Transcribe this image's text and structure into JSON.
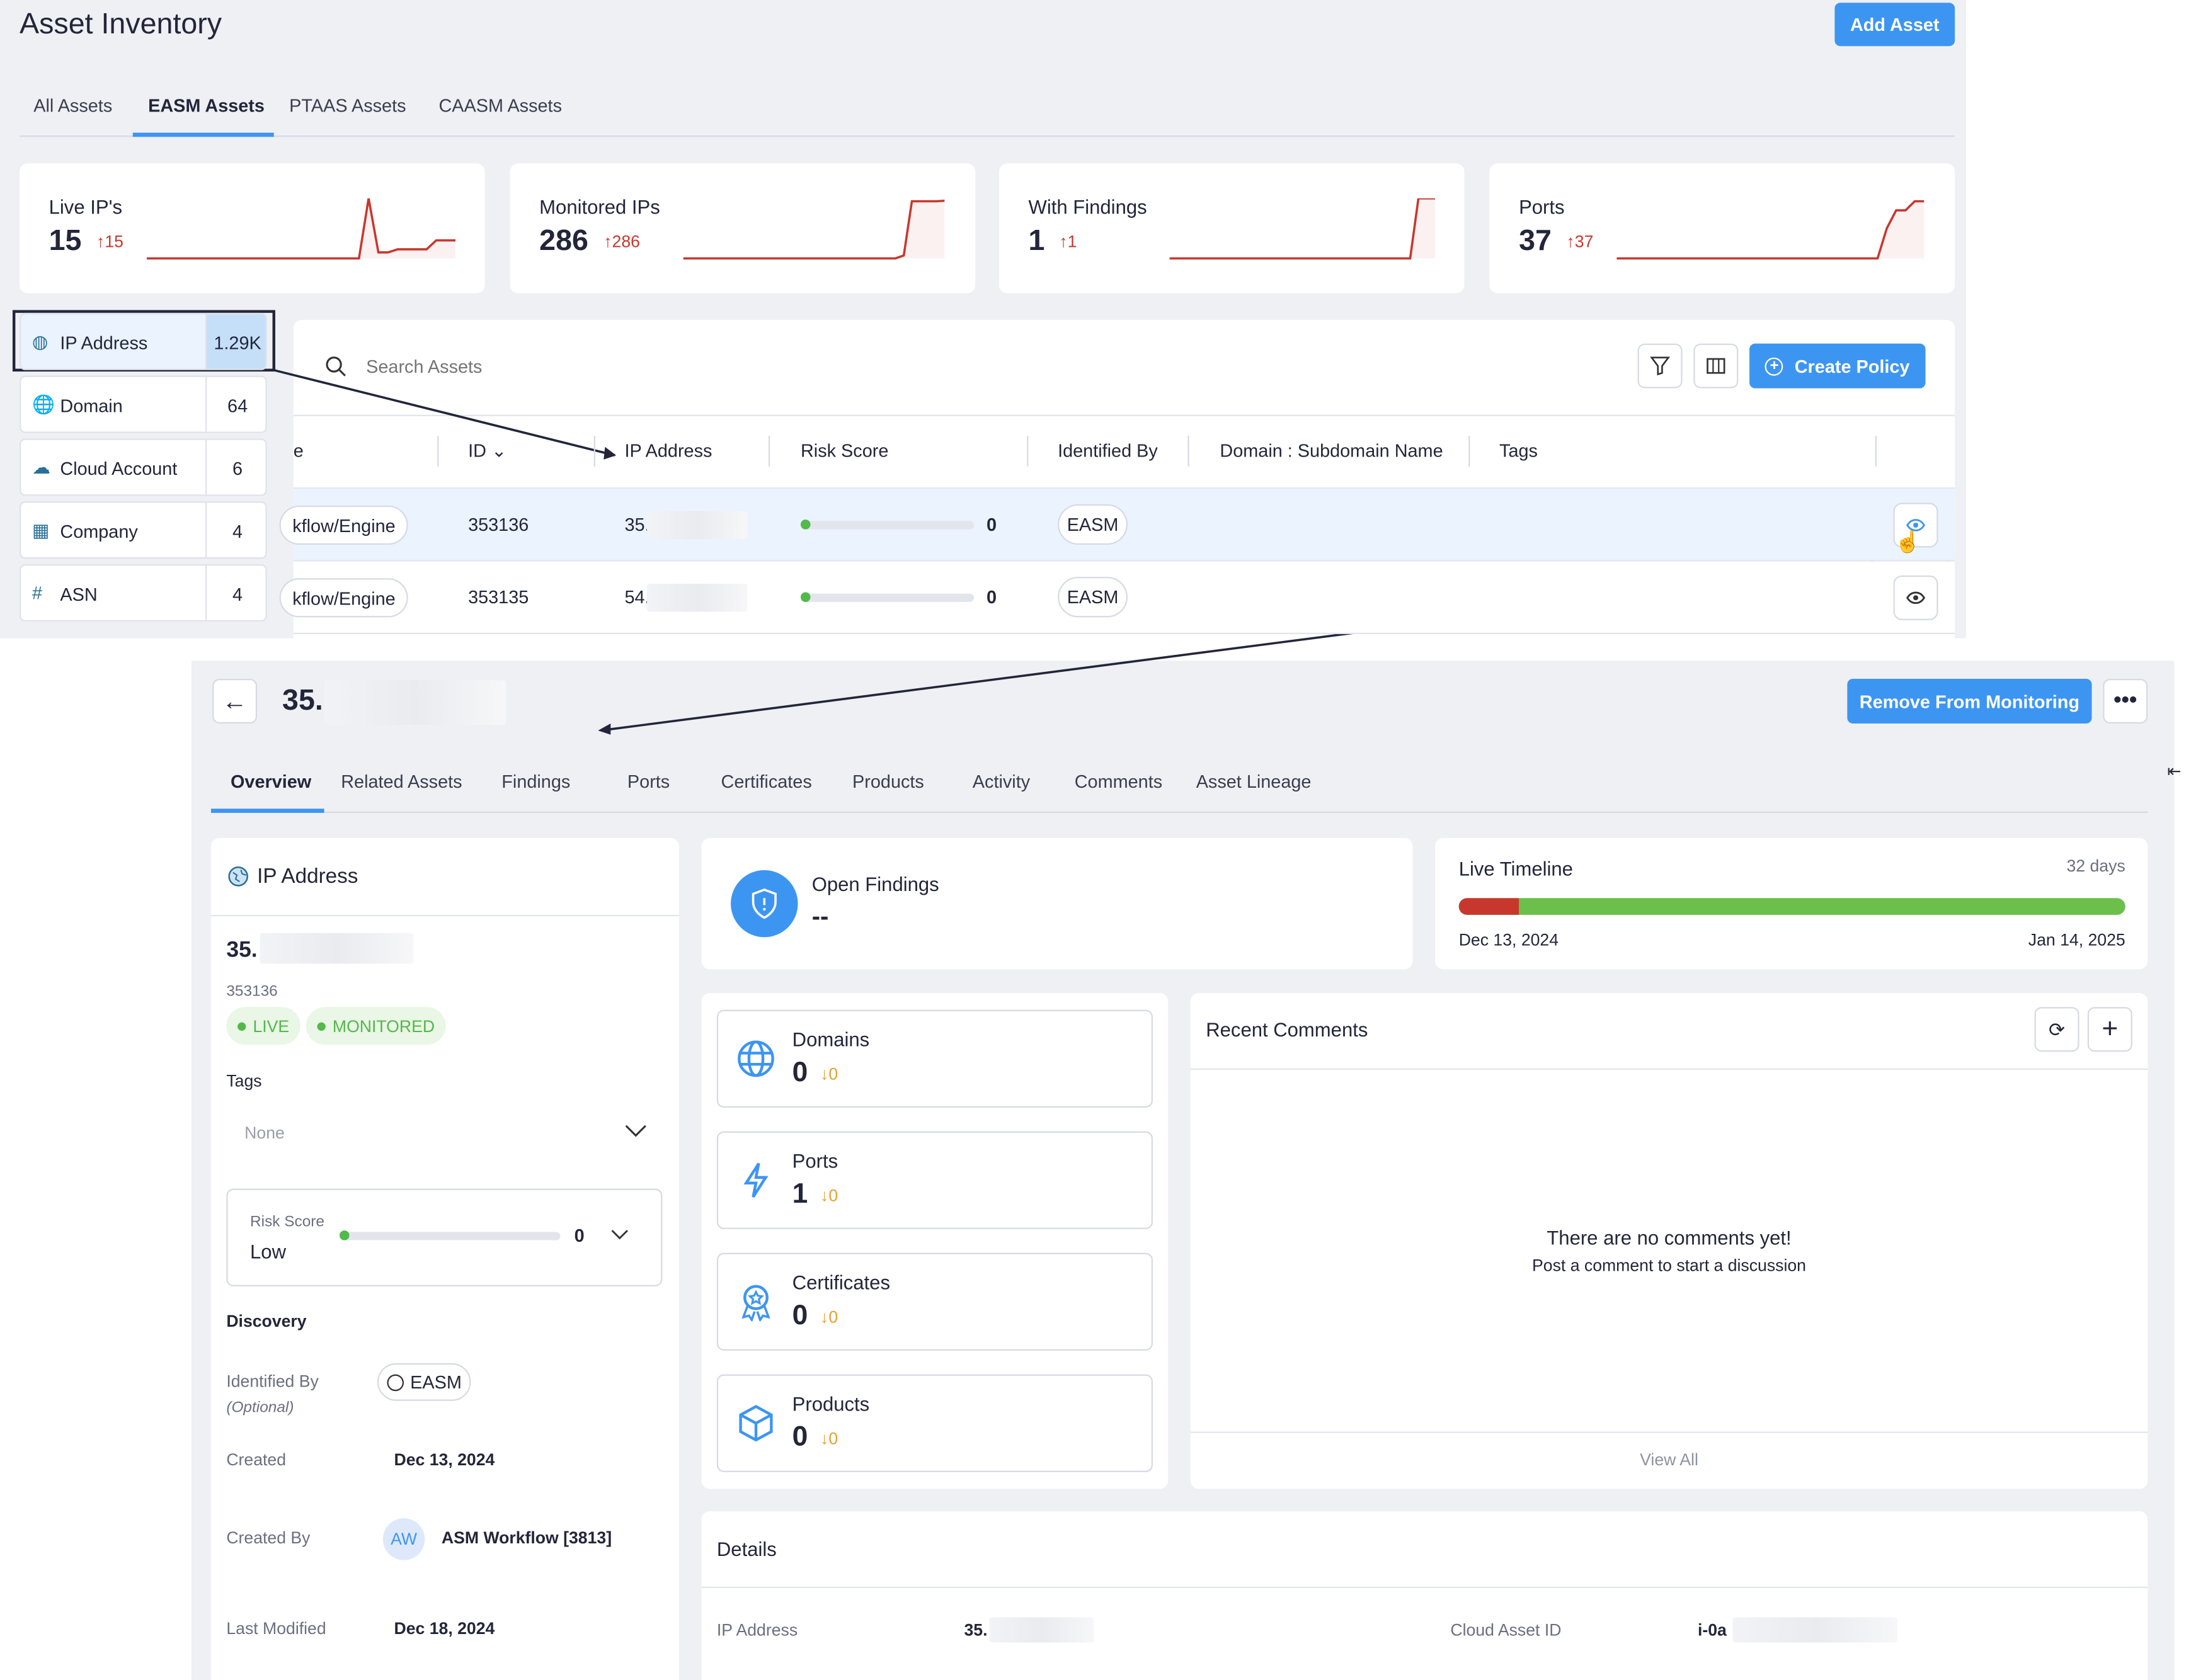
{
  "header": {
    "title": "Asset Inventory",
    "add_button": "Add Asset"
  },
  "tabs": [
    "All Assets",
    "EASM Assets",
    "PTAAS Assets",
    "CAASM Assets"
  ],
  "active_tab": 1,
  "stats": [
    {
      "label": "Live IP's",
      "value": "15",
      "delta": "15",
      "spark": [
        0,
        0,
        0,
        0,
        0,
        0,
        0,
        0,
        0,
        0,
        0,
        0,
        0,
        0,
        0,
        0,
        0,
        0,
        0,
        0,
        0,
        0,
        0,
        100,
        10,
        10,
        15,
        15,
        15,
        15,
        30,
        30,
        30
      ]
    },
    {
      "label": "Monitored IPs",
      "value": "286",
      "delta": "286",
      "spark": [
        0,
        0,
        0,
        0,
        0,
        0,
        0,
        0,
        0,
        0,
        0,
        0,
        0,
        0,
        0,
        0,
        0,
        0,
        0,
        0,
        0,
        0,
        0,
        0,
        0,
        0,
        0,
        5,
        95,
        95,
        95,
        95,
        96
      ]
    },
    {
      "label": "With Findings",
      "value": "1",
      "delta": "1",
      "spark": [
        0,
        0,
        0,
        0,
        0,
        0,
        0,
        0,
        0,
        0,
        0,
        0,
        0,
        0,
        0,
        0,
        0,
        0,
        0,
        0,
        0,
        0,
        0,
        0,
        0,
        0,
        0,
        0,
        0,
        0,
        100,
        100,
        100
      ]
    },
    {
      "label": "Ports",
      "value": "37",
      "delta": "37",
      "spark": [
        0,
        0,
        0,
        0,
        0,
        0,
        0,
        0,
        0,
        0,
        0,
        0,
        0,
        0,
        0,
        0,
        0,
        0,
        0,
        0,
        0,
        0,
        0,
        0,
        0,
        0,
        0,
        0,
        0,
        50,
        80,
        80,
        95,
        95
      ]
    }
  ],
  "colors": {
    "accent": "#3d95f2",
    "trend": "#c8372d",
    "live": "#52b94a",
    "timeline_red": "#c8372d",
    "timeline_green": "#6bbf4a",
    "delta_down": "#e8a030"
  },
  "asset_types": [
    {
      "label": "IP Address",
      "count": "1.29K",
      "icon": "ip-globe-icon",
      "active": true
    },
    {
      "label": "Domain",
      "count": "64",
      "icon": "globe-icon"
    },
    {
      "label": "Cloud Account",
      "count": "6",
      "icon": "cloud-icon"
    },
    {
      "label": "Company",
      "count": "4",
      "icon": "building-icon"
    },
    {
      "label": "ASN",
      "count": "4",
      "icon": "hash-icon"
    }
  ],
  "table": {
    "search_placeholder": "Search Assets",
    "create_policy": "Create Policy",
    "columns": [
      "e",
      "ID",
      "IP Address",
      "Risk Score",
      "Identified By",
      "Domain : Subdomain Name",
      "Tags"
    ],
    "rows": [
      {
        "source": "kflow/Engine",
        "id": "353136",
        "ip": "35.",
        "risk": "0",
        "identified_by": "EASM",
        "risk_fraction": 0
      },
      {
        "source": "kflow/Engine",
        "id": "353135",
        "ip": "54.",
        "risk": "0",
        "identified_by": "EASM",
        "risk_fraction": 0
      }
    ]
  },
  "detail": {
    "title": "35.",
    "remove_button": "Remove From Monitoring",
    "tabs": [
      "Overview",
      "Related Assets",
      "Findings",
      "Ports",
      "Certificates",
      "Products",
      "Activity",
      "Comments",
      "Asset Lineage"
    ],
    "active_tab": 0,
    "left": {
      "heading": "IP Address",
      "ip": "35.",
      "id": "353136",
      "badges": [
        "LIVE",
        "MONITORED"
      ],
      "tags_label": "Tags",
      "tags_value": "None",
      "risk_label": "Risk Score",
      "risk_level": "Low",
      "risk_value": "0",
      "risk_fraction": 0,
      "discovery": "Discovery",
      "identified_by_label": "Identified By",
      "optional": "(Optional)",
      "identified_by": "EASM",
      "created_label": "Created",
      "created": "Dec 13, 2024",
      "created_by_label": "Created By",
      "created_by_initials": "AW",
      "created_by": "ASM Workflow [3813]",
      "modified_label": "Last Modified",
      "modified": "Dec 18, 2024"
    },
    "open_findings": {
      "label": "Open Findings",
      "value": "--"
    },
    "timeline": {
      "label": "Live Timeline",
      "duration": "32 days",
      "start": "Dec 13, 2024",
      "end": "Jan 14, 2025",
      "red_fraction": 0.09
    },
    "counts": [
      {
        "label": "Domains",
        "value": "0",
        "delta": "0",
        "icon": "globe-icon"
      },
      {
        "label": "Ports",
        "value": "1",
        "delta": "0",
        "icon": "lightning-icon"
      },
      {
        "label": "Certificates",
        "value": "0",
        "delta": "0",
        "icon": "certificate-icon"
      },
      {
        "label": "Products",
        "value": "0",
        "delta": "0",
        "icon": "box-icon"
      }
    ],
    "comments": {
      "title": "Recent Comments",
      "empty_title": "There are no comments yet!",
      "empty_sub": "Post a comment to start a discussion",
      "view_all": "View All"
    },
    "details": {
      "title": "Details",
      "ip_label": "IP Address",
      "ip": "35.",
      "cloud_label": "Cloud Asset ID",
      "cloud": "i-0a"
    }
  }
}
